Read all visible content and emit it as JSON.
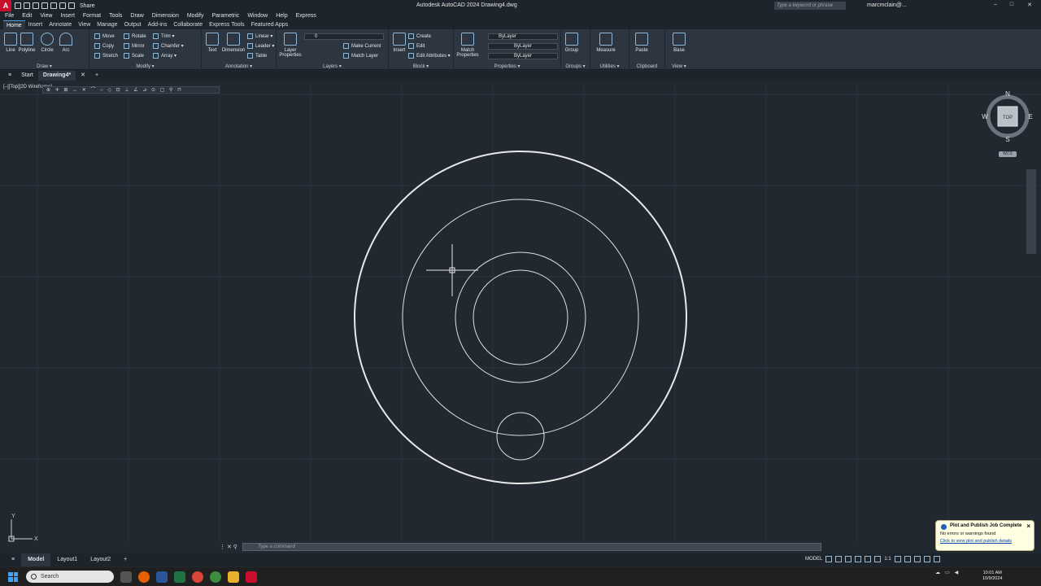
{
  "title_bar": {
    "logo": "A",
    "share": "Share",
    "app_title": "Autodesk AutoCAD 2024   Drawing4.dwg",
    "search_placeholder": "Type a keyword or phrase",
    "user": "marcmclain@...",
    "min": "–",
    "max": "□",
    "close": "✕"
  },
  "menu": [
    "File",
    "Edit",
    "View",
    "Insert",
    "Format",
    "Tools",
    "Draw",
    "Dimension",
    "Modify",
    "Parametric",
    "Window",
    "Help",
    "Express"
  ],
  "ribbon_tabs": [
    {
      "label": "Home"
    },
    {
      "label": "Insert"
    },
    {
      "label": "Annotate"
    },
    {
      "label": "View"
    },
    {
      "label": "Manage"
    },
    {
      "label": "Output"
    },
    {
      "label": "Add-ins"
    },
    {
      "label": "Collaborate"
    },
    {
      "label": "Express Tools"
    },
    {
      "label": "Featured Apps"
    }
  ],
  "ribbon": {
    "draw": {
      "title": "Draw ▾",
      "line": "Line",
      "polyline": "Polyline",
      "circle": "Circle",
      "arc": "Arc"
    },
    "modify": {
      "title": "Modify ▾",
      "move": "Move",
      "rotate": "Rotate",
      "trim": "Trim ▾",
      "copy": "Copy",
      "mirror": "Mirror",
      "fillet": "Chamfer ▾",
      "stretch": "Stretch",
      "scale": "Scale",
      "array": "Array ▾"
    },
    "annotation": {
      "title": "Annotation ▾",
      "text": "Text",
      "dimension": "Dimension",
      "linear": "Linear ▾",
      "leader": "Leader ▾",
      "table": "Table"
    },
    "layers": {
      "title": "Layers ▾",
      "layer_properties": "Layer Properties",
      "current_layer": "0",
      "make_current": "Make Current",
      "match_layer": "Match Layer"
    },
    "block": {
      "title": "Block ▾",
      "insert": "Insert",
      "create": "Create",
      "edit": "Edit",
      "edit_attributes": "Edit Attributes ▾"
    },
    "properties": {
      "title": "Properties ▾",
      "match_properties": "Match Properties",
      "color": "ByLayer",
      "linetype": "ByLayer",
      "lineweight": "ByLayer"
    },
    "groups": {
      "title": "Groups ▾",
      "group": "Group"
    },
    "utilities": {
      "title": "Utilities ▾",
      "measure": "Measure"
    },
    "clipboard": {
      "title": "Clipboard",
      "paste": "Paste"
    },
    "view": {
      "title": "View ▾",
      "base": "Base"
    }
  },
  "doc_tabs": {
    "start": "Start",
    "drawing": "Drawing4*",
    "close": "✕",
    "new": "+"
  },
  "viewport": {
    "label": "[–][Top][2D Wireframe]",
    "viewcube": {
      "n": "N",
      "s": "S",
      "e": "E",
      "w": "W",
      "face": "TOP",
      "wcs": "WCS"
    },
    "ucs_y": "Y",
    "ucs_x": "X"
  },
  "command_line": {
    "placeholder": "Type a command"
  },
  "layout_tabs": [
    {
      "label": "Model"
    },
    {
      "label": "Layout1"
    },
    {
      "label": "Layout2"
    }
  ],
  "status": {
    "model": "MODEL",
    "scale": "1:1"
  },
  "notification": {
    "title": "Plot and Publish Job Complete",
    "message": "No errors or warnings found",
    "link": "Click to view plot and publish details"
  },
  "taskbar": {
    "search": "Search",
    "time": "10:01 AM",
    "date": "10/9/2024"
  }
}
